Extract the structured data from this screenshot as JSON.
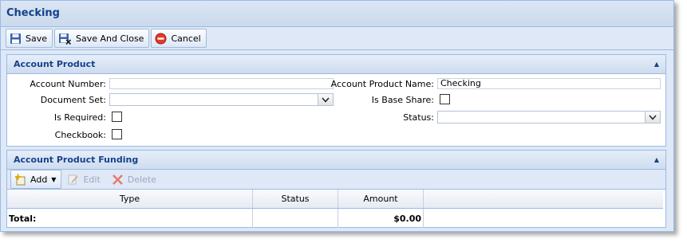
{
  "window": {
    "title": "Checking"
  },
  "toolbar": {
    "save": "Save",
    "save_and_close": "Save And Close",
    "cancel": "Cancel"
  },
  "account_product": {
    "header": "Account Product",
    "account_number_label": "Account Number:",
    "account_number_value": "",
    "document_set_label": "Document Set:",
    "document_set_value": "",
    "is_required_label": "Is Required:",
    "checkbook_label": "Checkbook:",
    "account_product_name_label": "Account Product Name:",
    "account_product_name_value": "Checking",
    "is_base_share_label": "Is Base Share:",
    "status_label": "Status:",
    "status_value": ""
  },
  "funding": {
    "header": "Account Product Funding",
    "add": "Add",
    "edit": "Edit",
    "delete": "Delete",
    "columns": [
      "Type",
      "Status",
      "Amount"
    ],
    "total_label": "Total:",
    "total_amount": "$0.00"
  },
  "colors": {
    "title_text": "#15428b",
    "border": "#99bbe8",
    "window_bg": "#dfe8f6"
  }
}
